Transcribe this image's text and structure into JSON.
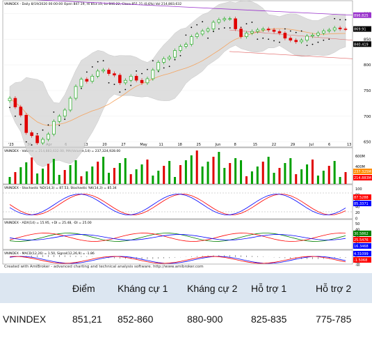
{
  "chart_data": [
    {
      "type": "candlestick",
      "title": "VNINDEX - Daily 8/19/2020 00:00:00 Open 847.19, Hi 853.15, Lo 846.22, Close 851.21 (0.6%) Vol 214,883,632",
      "legend_extra": [
        "MA(Close,45) = 831.16",
        "MidMA(Close,45) = 846.91",
        "Long MA(Close,100) = 826.54"
      ],
      "x_ticks": [
        "'23",
        "30",
        "Apr",
        "6",
        "13",
        "20",
        "27",
        "May",
        "11",
        "18",
        "25",
        "Jun",
        "8",
        "15",
        "22",
        "29",
        "Jul",
        "6",
        "13"
      ],
      "y_ticks": [
        650,
        700,
        750,
        800,
        850,
        900
      ],
      "ylim": [
        640,
        925
      ],
      "price_tags": [
        {
          "value": 896.825,
          "label": "896.825",
          "color": "#9932cc"
        },
        {
          "value": 869.91,
          "label": "869.91",
          "color": "#000000"
        },
        {
          "value": 840.419,
          "label": "840.419",
          "color": "#000000"
        }
      ],
      "series": [
        {
          "name": "close",
          "values": [
            735,
            718,
            702,
            668,
            662,
            648,
            655,
            665,
            690,
            700,
            712,
            735,
            758,
            772,
            768,
            778,
            788,
            790,
            783,
            780,
            765,
            770,
            778,
            770,
            765,
            773,
            790,
            805,
            812,
            815,
            828,
            836,
            840,
            855,
            860,
            866,
            870,
            883,
            888,
            890,
            890,
            870,
            855,
            862,
            865,
            868,
            870,
            868,
            865,
            862,
            852,
            848,
            845,
            848,
            856,
            858,
            862,
            866,
            868,
            872,
            870,
            869.91
          ]
        }
      ]
    },
    {
      "type": "bar",
      "title": "VNINDEX - Volume = 214,883,632.00, MA(Volume,14) = 237,324,928.00",
      "y_ticks": [
        "600M",
        "400M",
        "200M"
      ],
      "tags": [
        {
          "label": "237.325M",
          "color": "#ff8c00"
        },
        {
          "label": "214.883M",
          "color": "#ff0000"
        }
      ]
    },
    {
      "type": "line",
      "title": "VNINDEX - Stochastic %D(14,3) = 87.53, Stochastic %K(14,3) = 85.34",
      "y_ticks": [
        100,
        80,
        60,
        40,
        20,
        0
      ],
      "tags": [
        {
          "label": "87.5288",
          "color": "#ff0000"
        },
        {
          "label": "85.3371",
          "color": "#0000ff"
        }
      ]
    },
    {
      "type": "line",
      "title": "VNINDEX - ADX(14) = 15.95, +DI = 25.48, -DI = 25.00",
      "y_ticks": [
        50,
        40,
        30,
        20,
        10
      ],
      "tags": [
        {
          "label": "30.5862",
          "color": "#008000"
        },
        {
          "label": "25.5476",
          "color": "#ff0000"
        },
        {
          "label": "16.3468",
          "color": "#0000ff"
        }
      ]
    },
    {
      "type": "line",
      "title": "VNINDEX - MACD(12,26) = 1.50, Signal(12,26,9) = -1.86",
      "y_ticks": [
        40,
        20,
        0,
        -20,
        -40,
        -60
      ],
      "tags": [
        {
          "label": "4.31099",
          "color": "#0000ff"
        },
        {
          "label": "-1.5068",
          "color": "#ff0000"
        }
      ]
    }
  ],
  "credit": "Created with AmiBroker - advanced charting and technical analysis software. http://www.amibroker.com",
  "levels_table": {
    "headers": [
      "",
      "Điểm",
      "Kháng cự 1",
      "Kháng cự 2",
      "Hỗ trợ 1",
      "Hỗ trợ 2"
    ],
    "row": {
      "ticker": "VNINDEX",
      "price": "851,21",
      "r1": "852-860",
      "r2": "880-900",
      "s1": "825-835",
      "s2": "775-785"
    }
  },
  "colors": {
    "up": "#00a000",
    "down": "#e00000",
    "band": "#d3d3d3",
    "resistance": "#9932cc",
    "header_bg": "#dce6f1"
  }
}
